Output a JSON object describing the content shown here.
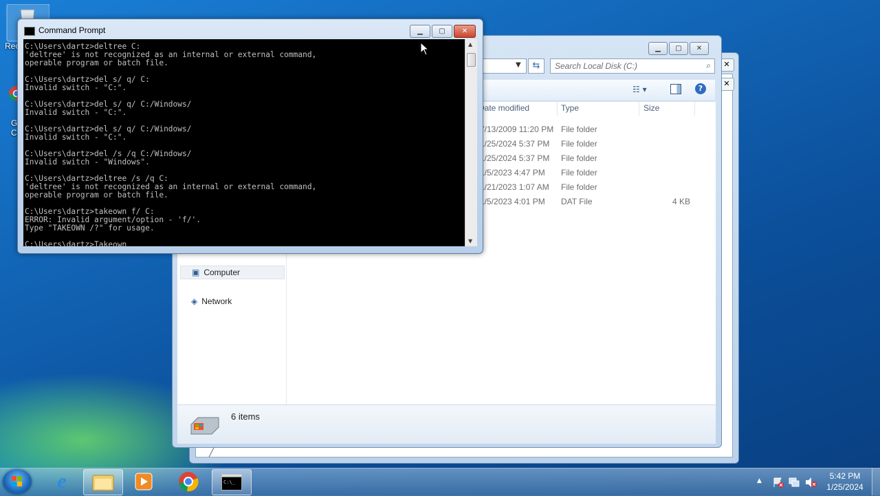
{
  "desktop": {
    "icons": [
      {
        "label": "Rec",
        "icon": "recycle-bin-icon"
      },
      {
        "label": "G\nCl",
        "icon": "chrome-icon"
      }
    ]
  },
  "explorer": {
    "search_placeholder": "Search Local Disk (C:)",
    "columns": {
      "date": "Date modified",
      "type": "Type",
      "size": "Size"
    },
    "rows": [
      {
        "date": "7/13/2009 11:20 PM",
        "type": "File folder",
        "size": ""
      },
      {
        "date": "1/25/2024 5:37 PM",
        "type": "File folder",
        "size": ""
      },
      {
        "date": "1/25/2024 5:37 PM",
        "type": "File folder",
        "size": ""
      },
      {
        "date": "1/5/2023 4:47 PM",
        "type": "File folder",
        "size": ""
      },
      {
        "date": "1/21/2023 1:07 AM",
        "type": "File folder",
        "size": ""
      },
      {
        "date": "1/5/2023 4:01 PM",
        "type": "DAT File",
        "size": "4 KB"
      }
    ],
    "nav": {
      "computer": "Computer",
      "network": "Network"
    },
    "details": {
      "count": "6 items"
    }
  },
  "cmd": {
    "title": "Command Prompt",
    "console_text": "C:\\Users\\dartz>deltree C:\n'deltree' is not recognized as an internal or external command,\noperable program or batch file.\n\nC:\\Users\\dartz>del s/ q/ C:\nInvalid switch - \"C:\".\n\nC:\\Users\\dartz>del s/ q/ C:/Windows/\nInvalid switch - \"C:\".\n\nC:\\Users\\dartz>del s/ q/ C:/Windows/\nInvalid switch - \"C:\".\n\nC:\\Users\\dartz>del /s /q C:/Windows/\nInvalid switch - \"Windows\".\n\nC:\\Users\\dartz>deltree /s /q C:\n'deltree' is not recognized as an internal or external command,\noperable program or batch file.\n\nC:\\Users\\dartz>takeown f/ C:\nERROR: Invalid argument/option - 'f/'.\nType \"TAKEOWN /?\" for usage.\n\nC:\\Users\\dartz>Takeown"
  },
  "taskbar": {
    "apps": [
      {
        "name": "Internet Explorer",
        "icon": "internet-explorer-icon"
      },
      {
        "name": "Windows Explorer",
        "icon": "folder-icon"
      },
      {
        "name": "Windows Media Player",
        "icon": "media-player-icon"
      },
      {
        "name": "Google Chrome",
        "icon": "chrome-icon"
      },
      {
        "name": "Command Prompt",
        "icon": "cmd-icon"
      }
    ],
    "time": "5:42 PM",
    "date": "1/25/2024"
  }
}
